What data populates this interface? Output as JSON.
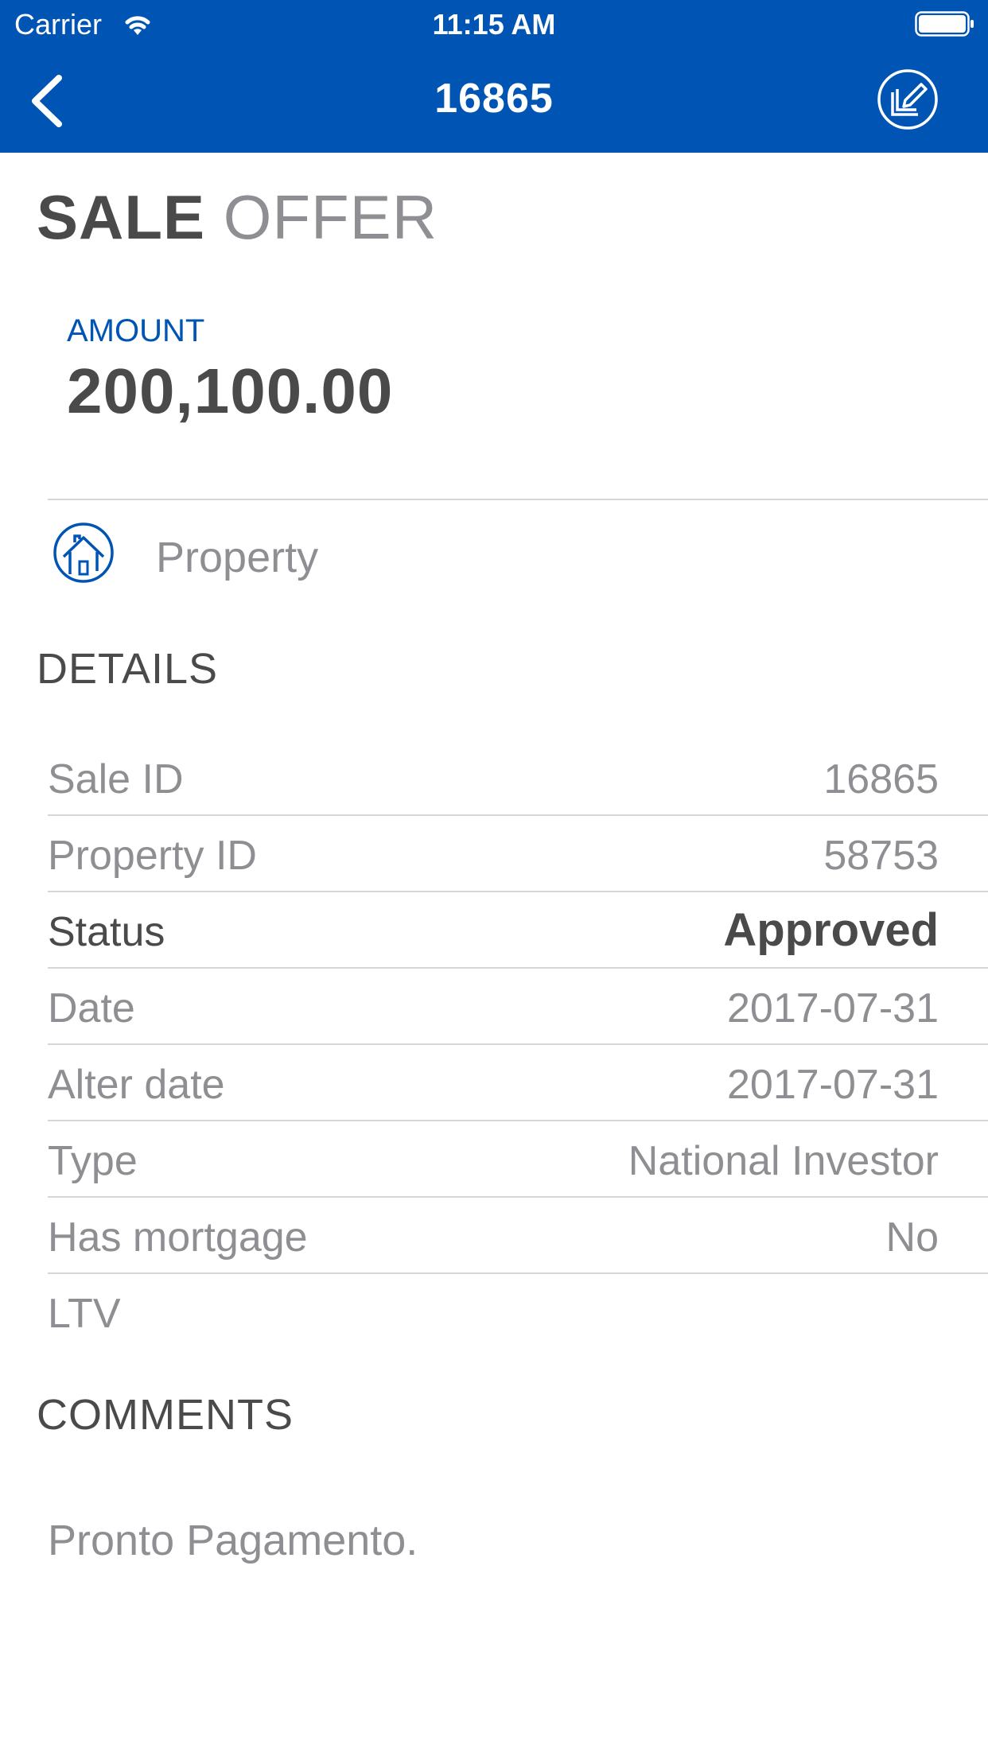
{
  "status_bar": {
    "carrier": "Carrier",
    "time": "11:15 AM"
  },
  "nav": {
    "title": "16865",
    "back_icon": "chevron-left-icon",
    "edit_icon": "edit-note-icon"
  },
  "colors": {
    "brand": "#0054b4",
    "text_dark": "#4a4a4a",
    "text_light": "#8e8e93",
    "divider": "#d6d6d6"
  },
  "title": {
    "bold": "SALE",
    "light": "OFFER"
  },
  "amount": {
    "label": "AMOUNT",
    "value": "200,100.00"
  },
  "property": {
    "label": "Property",
    "icon": "house-icon"
  },
  "details": {
    "header": "DETAILS",
    "rows": [
      {
        "key": "Sale ID",
        "value": "16865"
      },
      {
        "key": "Property ID",
        "value": "58753"
      },
      {
        "key": "Status",
        "value": "Approved"
      },
      {
        "key": "Date",
        "value": "2017-07-31"
      },
      {
        "key": "Alter date",
        "value": "2017-07-31"
      },
      {
        "key": "Type",
        "value": "National Investor"
      },
      {
        "key": "Has mortgage",
        "value": "No"
      },
      {
        "key": "LTV",
        "value": ""
      }
    ]
  },
  "comments": {
    "header": "COMMENTS",
    "text": "Pronto Pagamento."
  }
}
